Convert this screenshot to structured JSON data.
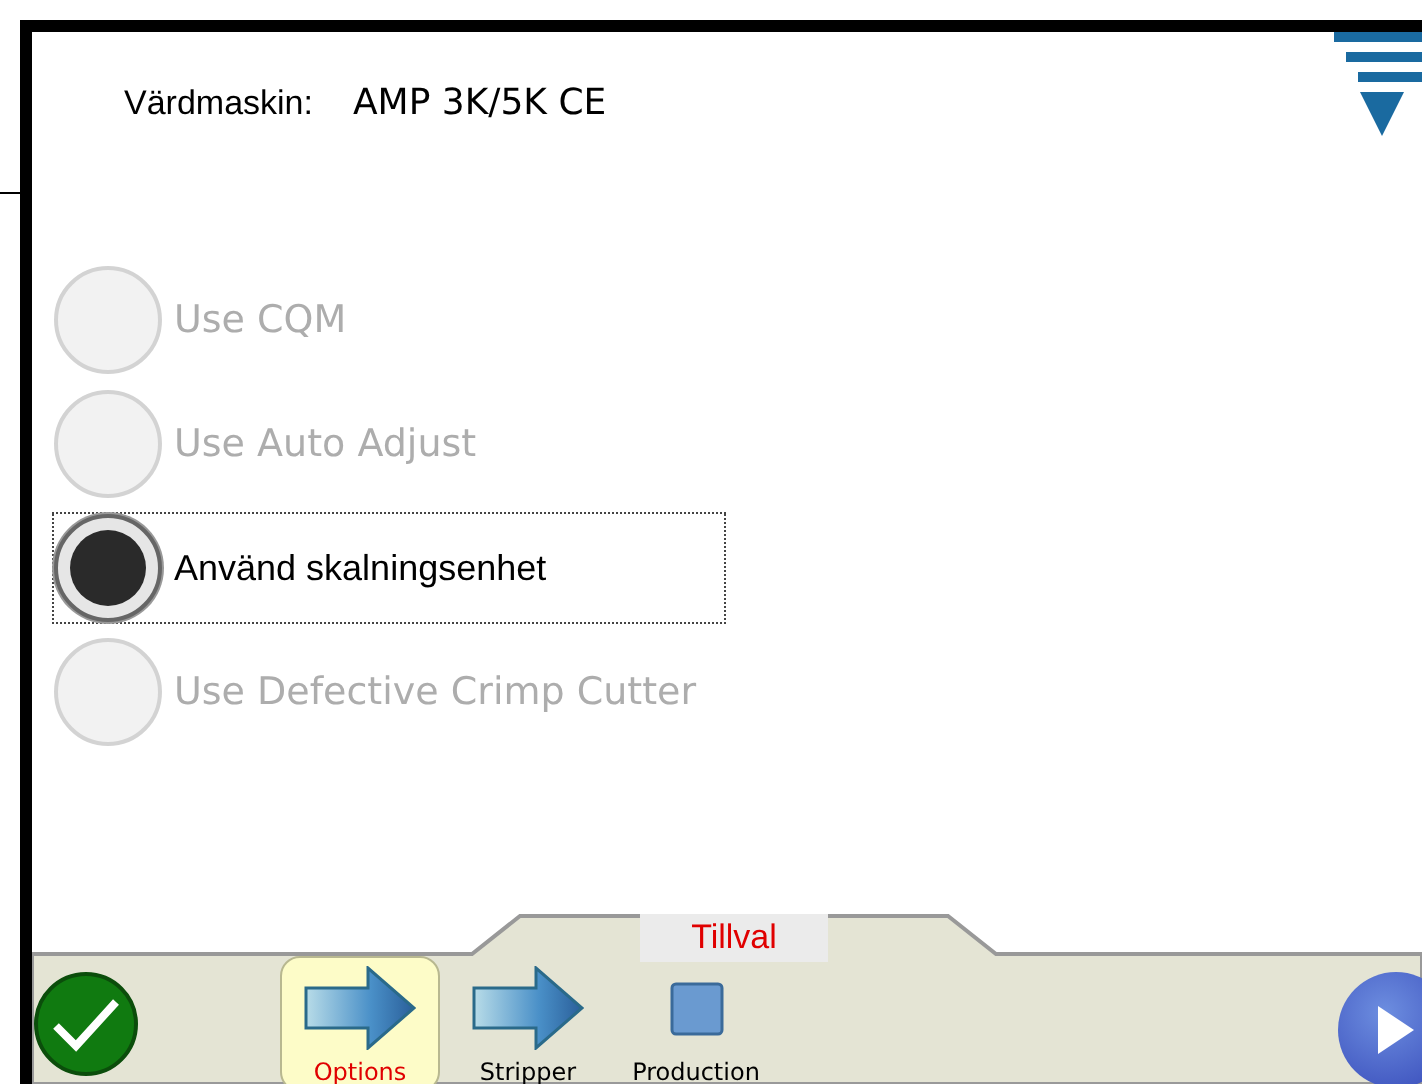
{
  "header": {
    "label": "Värdmaskin:",
    "value": "AMP 3K/5K CE"
  },
  "options": [
    {
      "label": "Use CQM",
      "selected": false,
      "disabled": true
    },
    {
      "label": "Use Auto Adjust",
      "selected": false,
      "disabled": true
    },
    {
      "label": "Använd skalningsenhet",
      "selected": true,
      "disabled": false
    },
    {
      "label": "Use Defective Crimp Cutter",
      "selected": false,
      "disabled": true
    }
  ],
  "footer": {
    "title": "Tillval",
    "steps": [
      {
        "label": "Options",
        "kind": "arrow",
        "selected": true
      },
      {
        "label": "Stripper",
        "kind": "arrow",
        "selected": false
      },
      {
        "label": "Production",
        "kind": "square",
        "selected": false
      }
    ]
  }
}
